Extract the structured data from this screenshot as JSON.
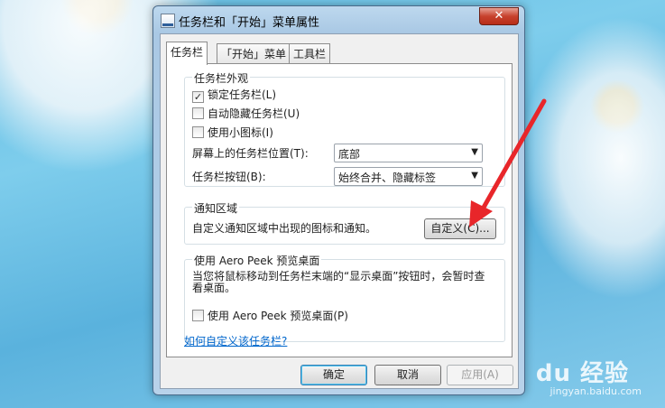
{
  "dialog": {
    "title": "任务栏和「开始」菜单属性",
    "close_label": "✕",
    "tabs": [
      {
        "label": "任务栏",
        "active": true
      },
      {
        "label": "「开始」菜单",
        "active": false
      },
      {
        "label": "工具栏",
        "active": false
      }
    ],
    "appearance": {
      "legend": "任务栏外观",
      "lock_label": "锁定任务栏(L)",
      "lock_checked": true,
      "autohide_label": "自动隐藏任务栏(U)",
      "autohide_checked": false,
      "small_icons_label": "使用小图标(I)",
      "small_icons_checked": false,
      "location_label": "屏幕上的任务栏位置(T):",
      "location_value": "底部",
      "buttons_label": "任务栏按钮(B):",
      "buttons_value": "始终合并、隐藏标签"
    },
    "notification": {
      "legend": "通知区域",
      "text": "自定义通知区域中出现的图标和通知。",
      "customize_button": "自定义(C)..."
    },
    "aero_peek": {
      "legend": "使用 Aero Peek 预览桌面",
      "description": "当您将鼠标移动到任务栏末端的“显示桌面”按钮时，会暂时查看桌面。",
      "checkbox_label": "使用 Aero Peek 预览桌面(P)",
      "checked": false
    },
    "help_link": "如何自定义该任务栏?",
    "buttons": {
      "ok": "确定",
      "cancel": "取消",
      "apply": "应用(A)"
    }
  },
  "watermark": {
    "main": "Bai du 经验",
    "sub": "jingyan.baidu.com"
  },
  "colors": {
    "accent_arrow": "#e8262a",
    "link": "#0066cc"
  }
}
